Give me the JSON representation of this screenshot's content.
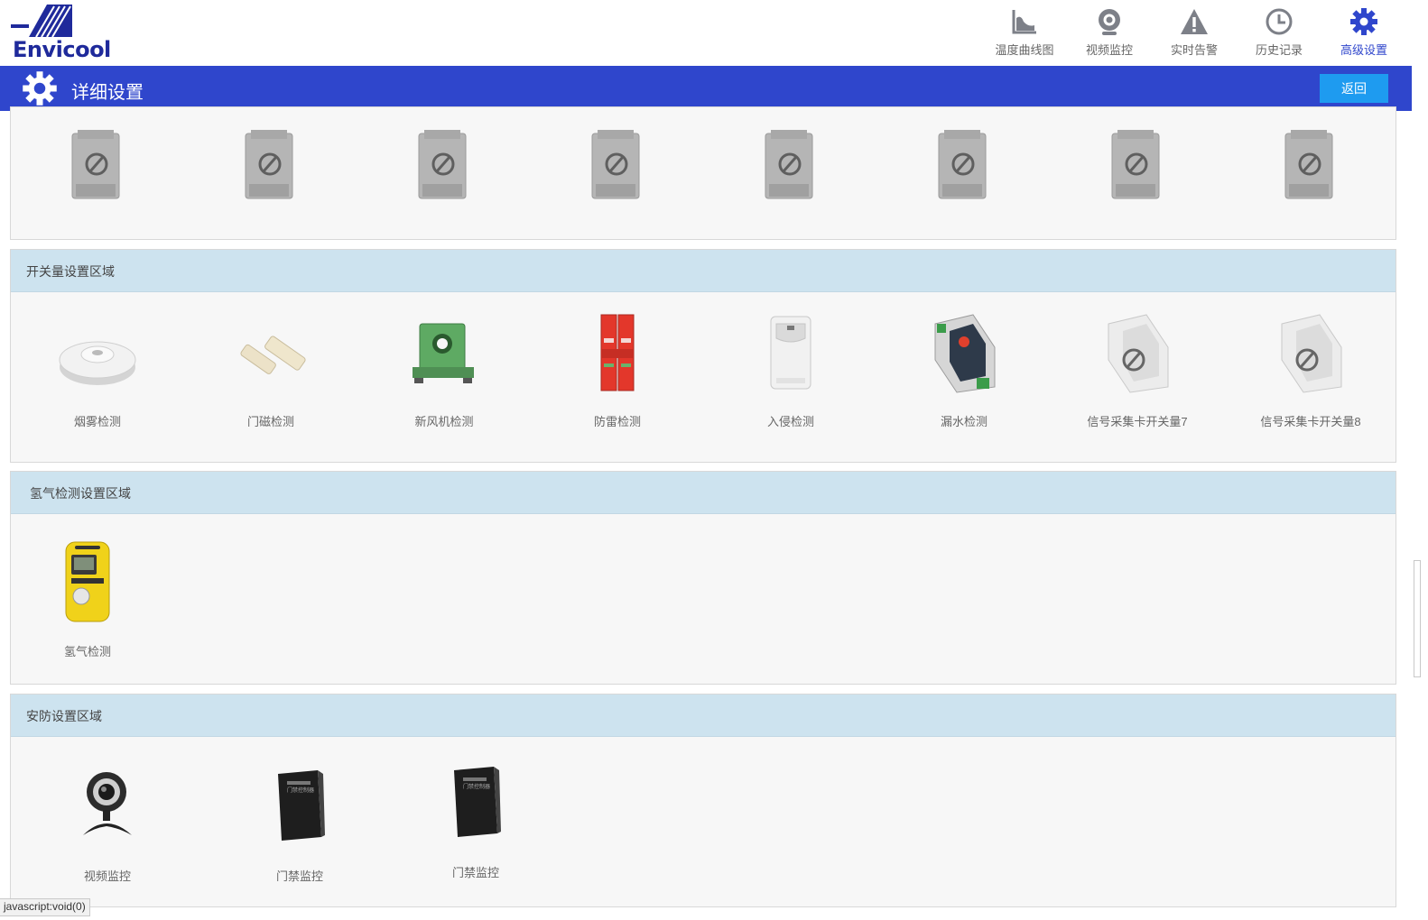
{
  "header": {
    "logo_text": "Envicool",
    "nav": [
      {
        "label": "温度曲线图",
        "icon": "area-chart-icon"
      },
      {
        "label": "视频监控",
        "icon": "webcam-icon"
      },
      {
        "label": "实时告警",
        "icon": "warning-icon"
      },
      {
        "label": "历史记录",
        "icon": "clock-icon"
      },
      {
        "label": "高级设置",
        "icon": "gear-icon"
      }
    ],
    "active_nav": "高级设置"
  },
  "titlebar": {
    "title": "详细设置",
    "back_label": "返回"
  },
  "sections": {
    "analog_cards": {
      "items": [
        "disabled-signal-card-icon",
        "disabled-signal-card-icon",
        "disabled-signal-card-icon",
        "disabled-signal-card-icon",
        "disabled-signal-card-icon",
        "disabled-signal-card-icon",
        "disabled-signal-card-icon",
        "disabled-signal-card-icon"
      ]
    },
    "switch": {
      "title": "开关量设置区域",
      "items": [
        {
          "label": "烟雾检测",
          "icon": "smoke-detector-icon"
        },
        {
          "label": "门磁检测",
          "icon": "door-magnet-icon"
        },
        {
          "label": "新风机检测",
          "icon": "current-sensor-icon"
        },
        {
          "label": "防雷检测",
          "icon": "surge-protector-icon"
        },
        {
          "label": "入侵检测",
          "icon": "infrared-detector-icon"
        },
        {
          "label": "漏水检测",
          "icon": "water-leak-module-icon"
        },
        {
          "label": "信号采集卡开关量7",
          "icon": "disabled-module-icon"
        },
        {
          "label": "信号采集卡开关量8",
          "icon": "disabled-module-icon"
        }
      ]
    },
    "hydrogen": {
      "title": "氢气检测设置区域",
      "items": [
        {
          "label": "氢气检测",
          "icon": "gas-detector-icon"
        }
      ]
    },
    "security": {
      "title": "安防设置区域",
      "items": [
        {
          "label": "视频监控",
          "icon": "webcam-device-icon"
        },
        {
          "label": "门禁监控",
          "icon": "access-controller-icon"
        },
        {
          "label": "门禁监控",
          "icon": "access-controller-icon"
        }
      ],
      "controller_caption": "门禁控制器"
    }
  },
  "statusbar": "javascript:void(0)"
}
